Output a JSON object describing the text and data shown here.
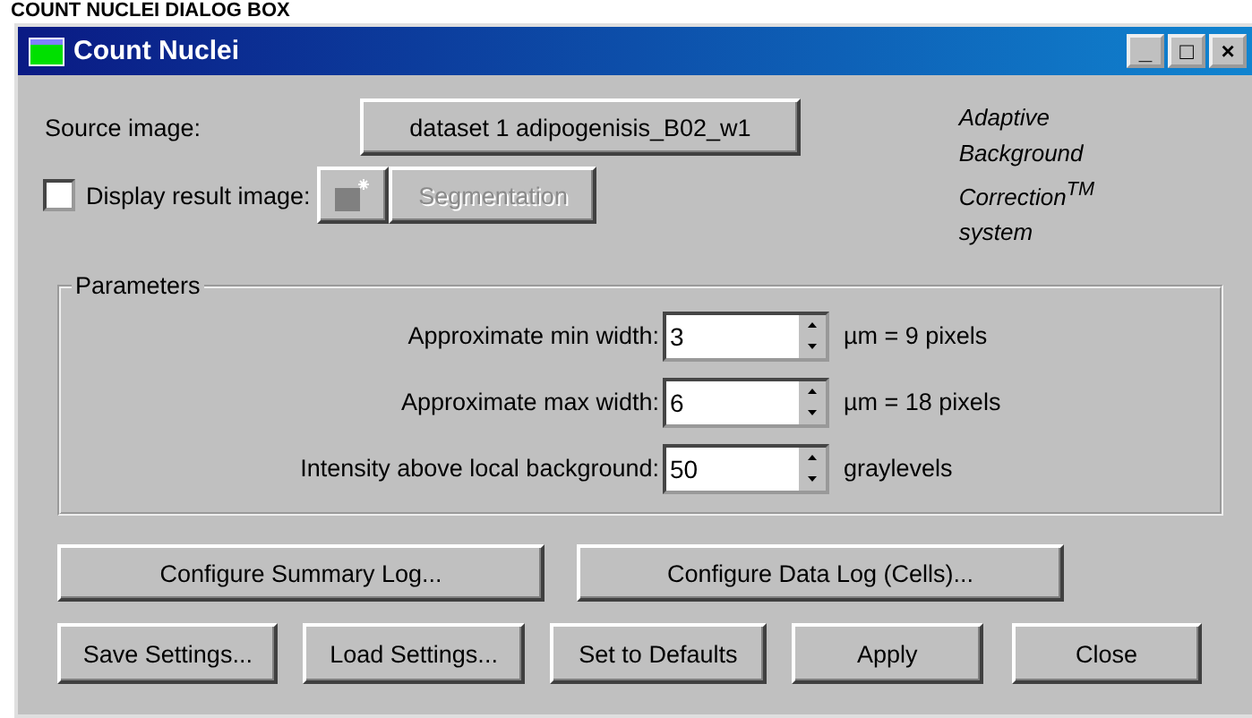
{
  "caption": "COUNT NUCLEI DIALOG BOX",
  "window": {
    "title": "Count Nuclei",
    "controls": [
      "_",
      "□",
      "×"
    ]
  },
  "source": {
    "label": "Source image:",
    "button": "dataset 1 adipogenisis_B02_w1"
  },
  "display": {
    "label": "Display result image:",
    "checked": false,
    "icon_disabled": true,
    "segmentation": {
      "label": "Segmentation",
      "disabled": true
    }
  },
  "brand": "Adaptive\nBackground\nCorrection$^{TM}$\nsystem",
  "parameters": {
    "title": "Parameters",
    "rows": [
      {
        "label": "Approximate min width:",
        "value": "3",
        "unit": "µm = 9 pixels"
      },
      {
        "label": "Approximate max width:",
        "value": "6",
        "unit": "µm = 18 pixels"
      },
      {
        "label": "Intensity above local background:",
        "value": "50",
        "unit": "graylevels"
      }
    ]
  },
  "log_buttons": [
    "Configure Summary Log...",
    "Configure Data Log (Cells)..."
  ],
  "buttons": [
    "Save Settings...",
    "Load Settings...",
    "Set to Defaults",
    "Apply",
    "Close"
  ]
}
